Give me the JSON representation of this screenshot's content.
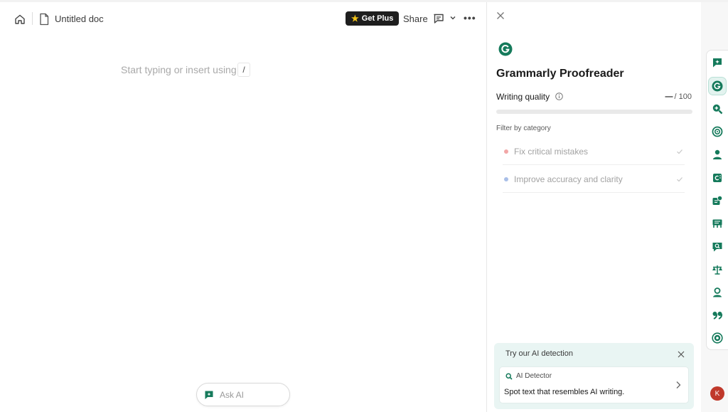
{
  "editor": {
    "doc_title": "Untitled doc",
    "get_plus_label": "Get Plus",
    "share_label": "Share",
    "placeholder": "Start typing or insert using",
    "slash_hint": "/",
    "ask_ai_label": "Ask AI"
  },
  "panel": {
    "title": "Grammarly Proofreader",
    "writing_quality_label": "Writing quality",
    "score_value": "—",
    "score_max": "/ 100",
    "progress_fraction": 0,
    "filter_label": "Filter by category",
    "categories": [
      {
        "label": "Fix critical mistakes",
        "dot_color": "#f2a7a7"
      },
      {
        "label": "Improve accuracy and clarity",
        "dot_color": "#a9bfe8"
      }
    ],
    "ai_card": {
      "title": "Try our AI detection",
      "tag": "AI Detector",
      "description": "Spot text that resembles AI writing."
    }
  },
  "rail": {
    "items": [
      "ai-chat-icon",
      "grammarly-proofreader-icon",
      "search-zoom-icon",
      "target-icon",
      "user-icon",
      "citation-icon",
      "expert-review-icon",
      "reader-icon",
      "plagiarism-check-icon",
      "balance-icon",
      "profile-icon",
      "quote-icon",
      "globe-icon"
    ],
    "active_index": 1
  },
  "avatar_initial": "K",
  "colors": {
    "brand_green": "#157a5b",
    "accent_teal": "#15c39a",
    "card_bg": "#e9f5f3"
  }
}
